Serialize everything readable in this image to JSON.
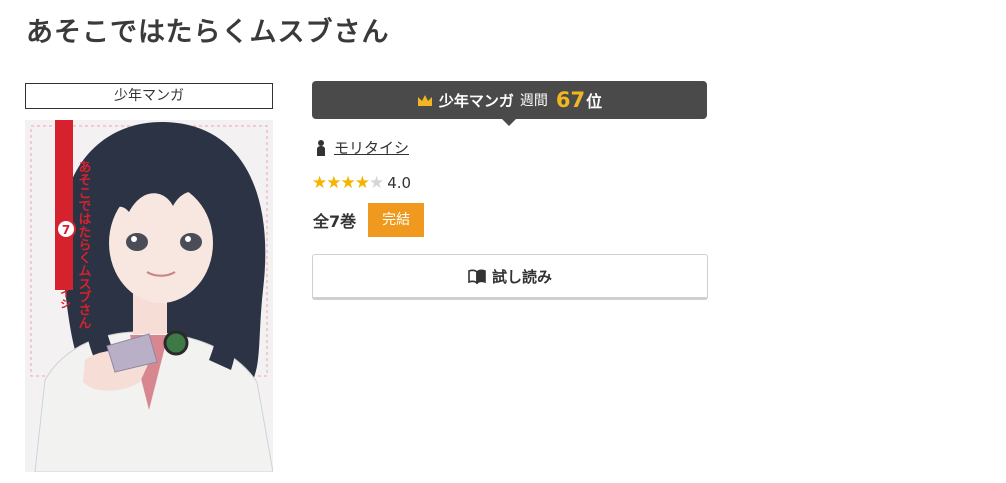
{
  "title": "あそこではたらくムスブさん",
  "genre": "少年マンガ",
  "cover": {
    "series_title": "あそこではたらくムスブさん",
    "volume": "7",
    "author": "モリタイシ"
  },
  "ranking": {
    "genre": "少年マンガ",
    "period": "週間",
    "rank": "67",
    "suffix": "位"
  },
  "author": "モリタイシ",
  "rating": {
    "stars": 4,
    "max": 5,
    "value": "4.0"
  },
  "volumes": "全7巻",
  "status": "完結",
  "trial_button": "試し読み",
  "colors": {
    "accent": "#ef9a1f",
    "rank_bar": "#4a4a4a",
    "rank_number": "#f2b720",
    "star": "#f4b400"
  }
}
